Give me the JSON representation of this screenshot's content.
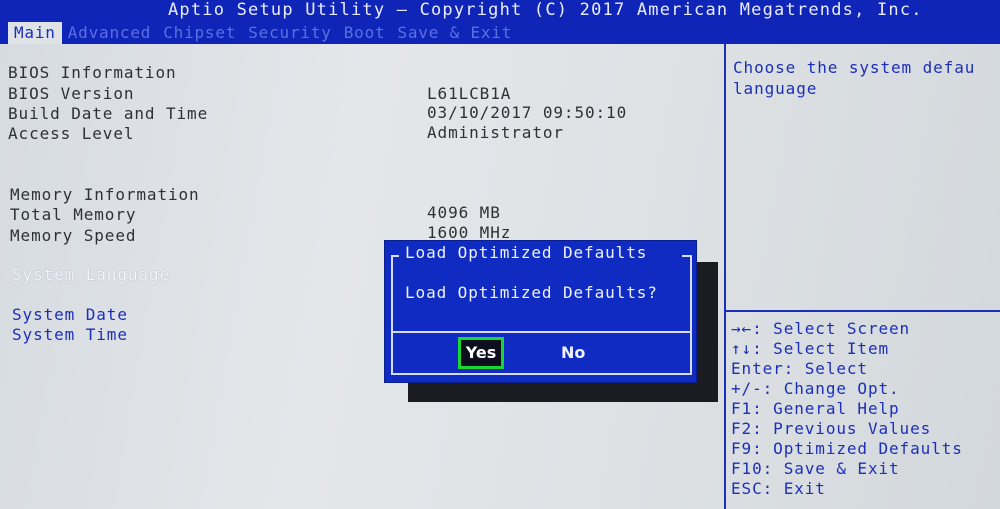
{
  "header": {
    "title": "Aptio Setup Utility – Copyright (C) 2017 American Megatrends, Inc.",
    "tabs": [
      {
        "label": "Main",
        "active": true
      },
      {
        "label": "Advanced",
        "active": false
      },
      {
        "label": "Chipset",
        "active": false
      },
      {
        "label": "Security",
        "active": false
      },
      {
        "label": "Boot",
        "active": false
      },
      {
        "label": "Save & Exit",
        "active": false
      }
    ]
  },
  "main": {
    "bios_info_heading": "BIOS Information",
    "bios_version_label": "BIOS Version",
    "bios_version_value": "L61LCB1A",
    "build_date_label": "Build Date and Time",
    "build_date_value": "03/10/2017 09:50:10",
    "access_level_label": "Access Level",
    "access_level_value": "Administrator",
    "memory_info_heading": "Memory Information",
    "total_memory_label": "Total Memory",
    "total_memory_value": "4096 MB",
    "memory_speed_label": "Memory Speed",
    "memory_speed_value": "1600 MHz",
    "system_language_label": "System Language",
    "system_date_label": "System Date",
    "system_time_label": "System Time"
  },
  "help": {
    "text_line1": "Choose the system defau",
    "text_line2": "language"
  },
  "keys": [
    {
      "key": "→←:",
      "action": "Select Screen"
    },
    {
      "key": "↑↓:",
      "action": "Select Item"
    },
    {
      "key": "Enter:",
      "action": "Select"
    },
    {
      "key": "+/-:",
      "action": "Change Opt."
    },
    {
      "key": "F1:",
      "action": "General Help"
    },
    {
      "key": "F2:",
      "action": "Previous Values"
    },
    {
      "key": "F9:",
      "action": "Optimized Defaults"
    },
    {
      "key": "F10:",
      "action": "Save & Exit"
    },
    {
      "key": "ESC:",
      "action": "Exit"
    }
  ],
  "dialog": {
    "title": "Load Optimized Defaults",
    "message": "Load Optimized Defaults?",
    "yes_label": "Yes",
    "no_label": "No",
    "selected": "Yes"
  },
  "colors": {
    "bios_blue": "#0e25b8",
    "selection_green": "#18d633"
  }
}
